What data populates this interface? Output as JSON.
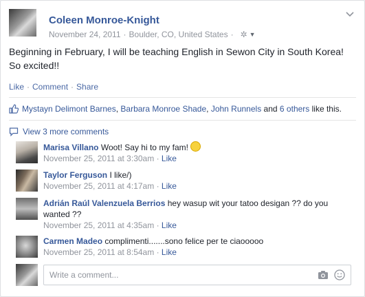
{
  "post": {
    "author": "Coleen Monroe-Knight",
    "date": "November 24, 2011",
    "location": "Boulder, CO, United States",
    "text": "Beginning in February, I will be teaching English in Sewon City in South Korea! So excited!!",
    "actions": {
      "like": "Like",
      "comment": "Comment",
      "share": "Share"
    }
  },
  "likes": {
    "names": [
      "Mystayn Delimont Barnes",
      "Barbara Monroe Shade",
      "John Runnels"
    ],
    "and": "and",
    "others": "6 others",
    "suffix": "like this."
  },
  "view_more": "View 3 more comments",
  "comments": [
    {
      "name": "Marisa Villano",
      "text": "Woot! Say hi to my fam!",
      "time": "November 25, 2011 at 3:30am",
      "like": "Like"
    },
    {
      "name": "Taylor Ferguson",
      "text": "I like/)",
      "time": "November 25, 2011 at 4:17am",
      "like": "Like"
    },
    {
      "name": "Adrián Raúl Valenzuela Berrios",
      "text": "hey wasup wit your tatoo desigan ?? do you wanted ??",
      "time": "November 25, 2011 at 4:35am",
      "like": "Like"
    },
    {
      "name": "Carmen Madeo",
      "text": "complimenti.......sono felice per te ciaooooo",
      "time": "November 25, 2011 at 8:54am",
      "like": "Like"
    }
  ],
  "reply": {
    "placeholder": "Write a comment..."
  },
  "colors": {
    "link": "#365899",
    "meta": "#90949c",
    "background": "#e9ebee"
  }
}
